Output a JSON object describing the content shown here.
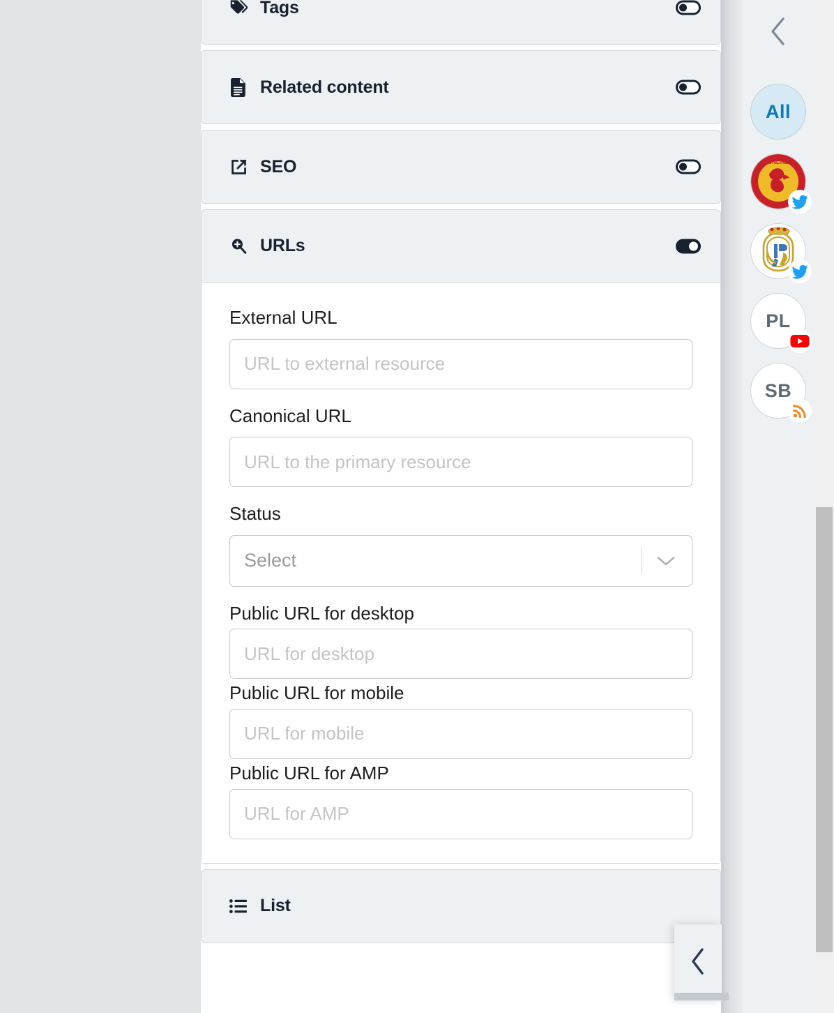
{
  "panel": {
    "sections": [
      {
        "id": "tags",
        "label": "Tags",
        "icon": "tag-icon",
        "enabled": false,
        "expanded": false
      },
      {
        "id": "related-content",
        "label": "Related content",
        "icon": "document-icon",
        "enabled": false,
        "expanded": false
      },
      {
        "id": "seo",
        "label": "SEO",
        "icon": "external-link-icon",
        "enabled": false,
        "expanded": false
      },
      {
        "id": "urls",
        "label": "URLs",
        "icon": "zoom-in-icon",
        "enabled": true,
        "expanded": true
      },
      {
        "id": "list",
        "label": "List",
        "icon": "list-icon",
        "enabled": false,
        "expanded": false
      }
    ]
  },
  "urls_form": {
    "external_url": {
      "label": "External URL",
      "placeholder": "URL to external resource",
      "value": ""
    },
    "canonical_url": {
      "label": "Canonical URL",
      "placeholder": "URL to the primary resource",
      "value": ""
    },
    "status": {
      "label": "Status",
      "placeholder": "Select",
      "value": ""
    },
    "public_url_desktop": {
      "label": "Public URL for desktop",
      "placeholder": "URL for desktop",
      "value": ""
    },
    "public_url_mobile": {
      "label": "Public URL for mobile",
      "placeholder": "URL for mobile",
      "value": ""
    },
    "public_url_amp": {
      "label": "Public URL for AMP",
      "placeholder": "URL for AMP",
      "value": ""
    }
  },
  "sidebar": {
    "collapse_icon": "chevron-left-icon",
    "accounts": [
      {
        "id": "all",
        "label": "All",
        "type": "filter",
        "badge": "none"
      },
      {
        "id": "lfc-online",
        "label": "LFC ONLINE",
        "type": "crest-lfc",
        "badge": "twitter-icon"
      },
      {
        "id": "real-madrid",
        "label": "",
        "type": "crest-realmadrid",
        "badge": "twitter-icon"
      },
      {
        "id": "pl",
        "label": "PL",
        "type": "initials",
        "badge": "youtube-icon"
      },
      {
        "id": "sb",
        "label": "SB",
        "type": "initials",
        "badge": "rss-icon"
      }
    ]
  },
  "floating": {
    "collapse_icon": "chevron-left-icon"
  },
  "colors": {
    "panel_bg": "#ffffff",
    "section_header_bg": "#eef1f4",
    "section_border": "#d2d8de",
    "gutter_bg": "#e3e4e5",
    "sidebar_bg": "#eef1f4",
    "text_dark": "#17222e",
    "placeholder": "#c4c4c4",
    "accent_blue": "#0b7ab8",
    "twitter": "#1da1f2",
    "youtube": "#ff0000",
    "rss": "#f08a24",
    "scrollbar_thumb": "#bfbfbf"
  }
}
